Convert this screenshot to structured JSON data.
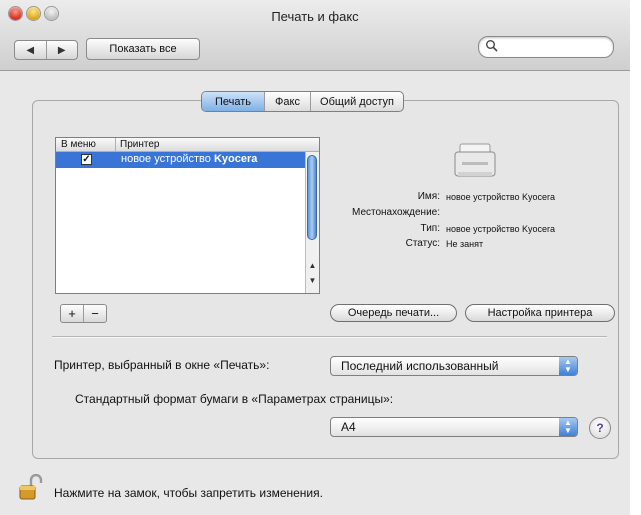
{
  "window": {
    "title": "Печать и факс"
  },
  "toolbar": {
    "back_glyph": "◀",
    "forward_glyph": "▶",
    "show_all_label": "Показать все",
    "search_placeholder": ""
  },
  "tabs": [
    {
      "label": "Печать",
      "selected": true
    },
    {
      "label": "Факс",
      "selected": false
    },
    {
      "label": "Общий доступ",
      "selected": false
    }
  ],
  "printer_list": {
    "columns": [
      "В меню",
      "Принтер"
    ],
    "rows": [
      {
        "in_menu": true,
        "name_prefix": "новое устройство ",
        "name_brand": "Kyocera",
        "selected": true
      }
    ]
  },
  "printer_info": {
    "name_label": "Имя:",
    "name_value": "новое устройство Kyocera",
    "location_label": "Местонахождение:",
    "location_value": "",
    "type_label": "Тип:",
    "type_value": "новое устройство Kyocera",
    "status_label": "Статус:",
    "status_value": "Не занят"
  },
  "buttons": {
    "add": "+",
    "remove": "−",
    "queue": "Очередь печати...",
    "setup": "Настройка принтера"
  },
  "settings": {
    "selected_printer_label": "Принтер, выбранный в окне «Печать»:",
    "selected_printer_value": "Последний использованный",
    "paper_label": "Стандартный формат бумаги в «Параметрах страницы»:",
    "paper_value": "A4",
    "help": "?"
  },
  "footer": {
    "lock_text": "Нажмите на замок, чтобы запретить изменения."
  },
  "colors": {
    "selection": "#3875d7",
    "accent_button": "#3f80d6"
  }
}
